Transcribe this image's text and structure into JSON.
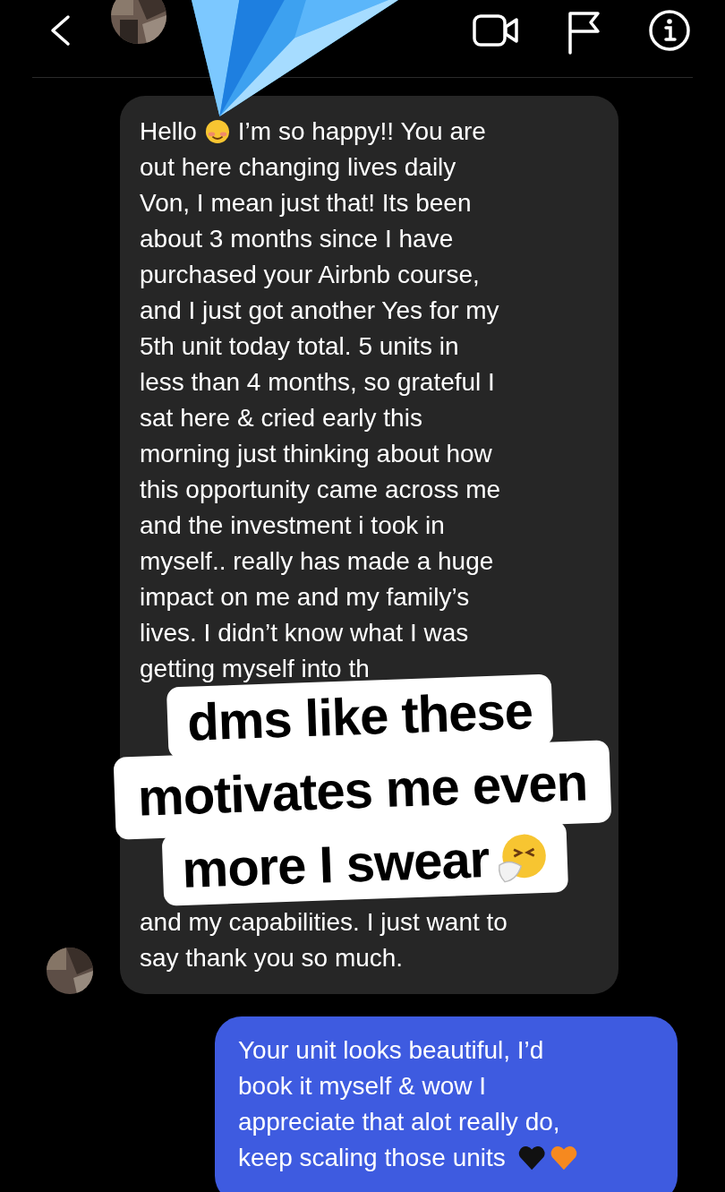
{
  "received_message": {
    "greeting": "Hello",
    "first_line": "I’m so happy!! You are",
    "text": "out here changing lives daily\nVon, I mean just that! Its been\nabout 3 months since I have\npurchased your Airbnb course,\nand I just got another Yes for my\n5th unit today total. 5 units in\nless than 4 months, so grateful I\nsat here & cried early this\nmorning just thinking about how\nthis opportunity came across me\nand the investment i took in\nmyself.. really has made a huge\nimpact on me and my family’s\nlives. I didn’t know what I was\ngetting myself into th",
    "continuation": "and my capabilities. I just want to\nsay thank you so much."
  },
  "caption_overlay": {
    "lines": [
      {
        "text": "dms like these",
        "trailing_emoji": false
      },
      {
        "text": "motivates me even",
        "trailing_emoji": false
      },
      {
        "text": "more I swear",
        "trailing_emoji": true
      }
    ]
  },
  "sent_message": {
    "text": "Your unit looks beautiful, I’d\nbook it myself & wow I\nappreciate that alot really do,",
    "last_line": "keep scaling those units",
    "hearts": true
  }
}
